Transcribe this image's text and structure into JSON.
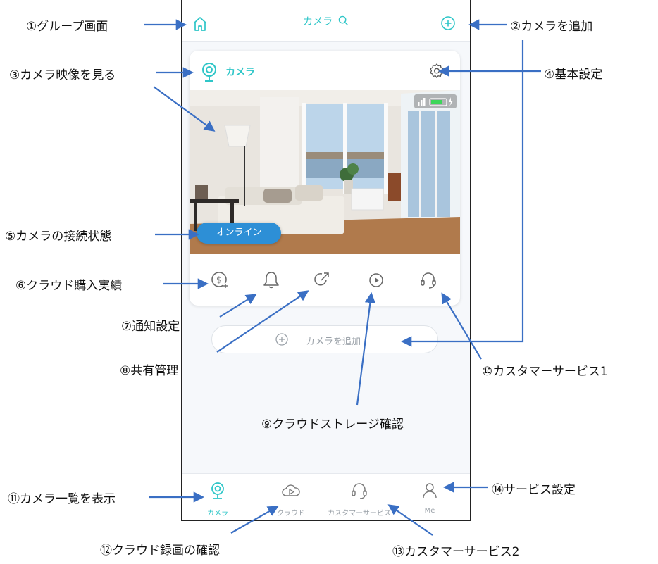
{
  "header": {
    "title": "カメラ",
    "home_icon": "home-icon",
    "add_icon": "plus-circle-icon"
  },
  "card": {
    "camera_name": "カメラ",
    "status": "オンライン"
  },
  "add_camera": {
    "label": "カメラを追加"
  },
  "tabs": [
    {
      "label": "カメラ",
      "icon": "camera-icon",
      "active": true
    },
    {
      "label": "クラウド",
      "icon": "cloud-icon",
      "active": false
    },
    {
      "label": "カスタマーサービス",
      "icon": "headset-icon",
      "active": false
    },
    {
      "label": "Me",
      "icon": "user-icon",
      "active": false
    }
  ],
  "annotations": {
    "a1": "①グループ画面",
    "a2": "②カメラを追加",
    "a3": "③カメラ映像を見る",
    "a4": "④基本設定",
    "a5": "⑤カメラの接続状態",
    "a6": "⑥クラウド購入実績",
    "a7": "⑦通知設定",
    "a8": "⑧共有管理",
    "a9": "⑨クラウドストレージ確認",
    "a10": "⑩カスタマーサービス1",
    "a11": "⑪カメラ一覧を表示",
    "a12": "⑫クラウド録画の確認",
    "a13": "⑬カスタマーサービス2",
    "a14": "⑭サービス設定"
  },
  "colors": {
    "accent": "#2fc6c8",
    "online_badge": "#2d8fd6",
    "arrow": "#3a6fc4"
  }
}
